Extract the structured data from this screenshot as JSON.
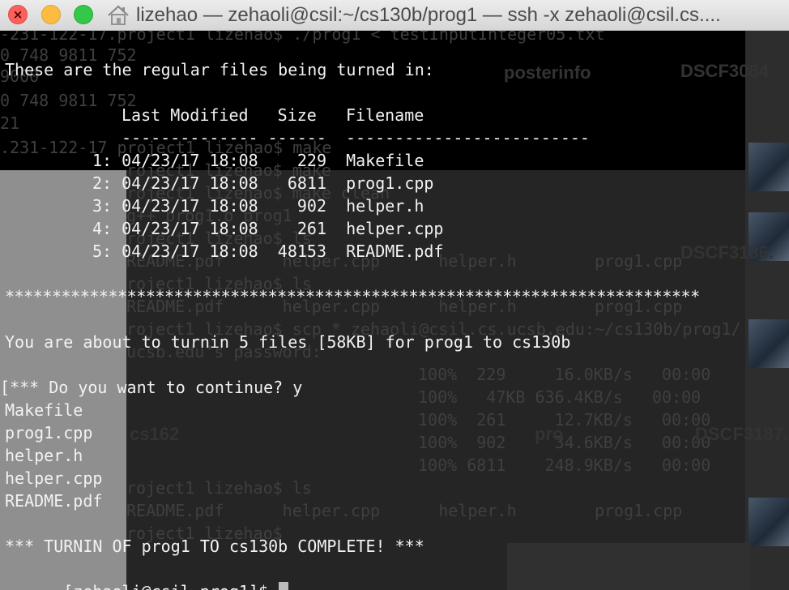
{
  "window": {
    "title": "lizehao — zehaoli@csil:~/cs130b/prog1 — ssh -x zehaoli@csil.cs...."
  },
  "icons": {
    "close": "close-icon",
    "minimize": "minimize-icon",
    "zoom": "zoom-icon",
    "home": "home-icon"
  },
  "colors": {
    "close": "#fc605c",
    "minimize": "#fdbc40",
    "zoom": "#34c84a",
    "terminal_bg": "#000000",
    "terminal_fg": "#f2f2f2"
  },
  "background": {
    "lines": [
      "-231-122-17.project1 lizehao$ ./prog1 < testInputInteger05.txt",
      "0 748 9811 752",
      "9000",
      "0 748 9811 752",
      "21",
      ".231-122-17 project1 lizehao$ make",
      "roject1 lizehao$ make",
      "roject1 lizehao$ make clean",
      "g++ prog1.o prog1",
      "roject1 lizehao$ ls",
      "README.pdf      helper.cpp      helper.h        prog1.cpp",
      "roject1 lizehao$ ls",
      "README.pdf      helper.cpp      helper.h        prog1.cpp",
      "roject1 lizehao$ scp * zehaoli@csil.cs.ucsb.edu:~/cs130b/prog1/",
      "ucsb.edu's password:",
      "100%  229     16.0KB/s   00:00",
      "100%   47KB 636.4KB/s   00:00",
      "100%  261     12.7KB/s   00:00",
      "100%  902     34.6KB/s   00:00",
      "100% 6811    248.9KB/s   00:00",
      "roject1 lizehao$ ls",
      "README.pdf      helper.cpp      helper.h        prog1.cpp",
      "roject1 lizehao$ "
    ],
    "desktop_labels": [
      "posterinfo",
      "DSCF3084",
      "DSCF3186.",
      "cs162",
      "DSCF3187.",
      "pro"
    ]
  },
  "terminal": {
    "intro": "These are the regular files being turned in:",
    "table_header": "Last Modified   Size   Filename",
    "table_rule": "-------------- ------  -------------------------",
    "files": [
      "1: 04/23/17 18:08    229  Makefile",
      "2: 04/23/17 18:08   6811  prog1.cpp",
      "3: 04/23/17 18:08    902  helper.h",
      "4: 04/23/17 18:08    261  helper.cpp",
      "5: 04/23/17 18:08  48153  README.pdf"
    ],
    "stars": "**************************************************************************",
    "about": "You are about to turnin 5 files [58KB] for prog1 to cs130b",
    "continue_prompt": "[*** Do you want to continue? y",
    "listing": [
      "Makefile",
      "prog1.cpp",
      "helper.h",
      "helper.cpp",
      "README.pdf"
    ],
    "complete": "*** TURNIN OF prog1 TO cs130b COMPLETE! ***",
    "prompt": "[zehaoli@csil prog1]$ "
  }
}
